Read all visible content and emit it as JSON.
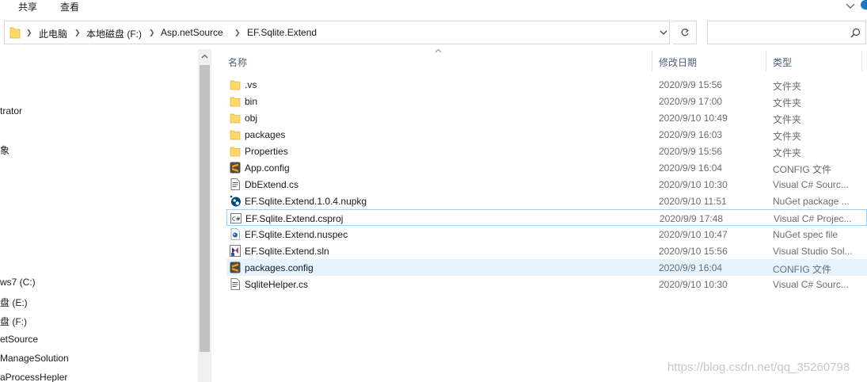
{
  "ribbon": {
    "tabs": [
      "共享",
      "查看"
    ]
  },
  "address": {
    "crumbs": [
      "此电脑",
      "本地磁盘 (F:)",
      "Asp.netSource",
      "EF.Sqlite.Extend"
    ],
    "search_placeholder": ""
  },
  "nav": {
    "items": [
      "trator",
      "象",
      "ws7 (C:)",
      "盘 (E:)",
      "盘 (F:)",
      "etSource",
      "ManageSolution",
      "aProcessHepler"
    ]
  },
  "columns": {
    "name": "名称",
    "date": "修改日期",
    "type": "类型"
  },
  "files": [
    {
      "name": ".vs",
      "date": "2020/9/9 15:56",
      "type": "文件夹",
      "icon": "folder-icon"
    },
    {
      "name": "bin",
      "date": "2020/9/9 17:00",
      "type": "文件夹",
      "icon": "folder-icon"
    },
    {
      "name": "obj",
      "date": "2020/9/10 10:49",
      "type": "文件夹",
      "icon": "folder-icon"
    },
    {
      "name": "packages",
      "date": "2020/9/9 16:03",
      "type": "文件夹",
      "icon": "folder-icon"
    },
    {
      "name": "Properties",
      "date": "2020/9/9 15:56",
      "type": "文件夹",
      "icon": "folder-icon"
    },
    {
      "name": "App.config",
      "date": "2020/9/9 16:04",
      "type": "CONFIG 文件",
      "icon": "sublime-file-icon"
    },
    {
      "name": "DbExtend.cs",
      "date": "2020/9/10 10:30",
      "type": "Visual C# Sourc...",
      "icon": "cs-file-icon"
    },
    {
      "name": "EF.Sqlite.Extend.1.0.4.nupkg",
      "date": "2020/9/10 11:51",
      "type": "NuGet package ...",
      "icon": "nuget-package-icon"
    },
    {
      "name": "EF.Sqlite.Extend.csproj",
      "date": "2020/9/9 17:48",
      "type": "Visual C# Projec...",
      "icon": "csproj-icon"
    },
    {
      "name": "EF.Sqlite.Extend.nuspec",
      "date": "2020/9/10 10:47",
      "type": "NuGet spec file",
      "icon": "nuspec-icon"
    },
    {
      "name": "EF.Sqlite.Extend.sln",
      "date": "2020/9/10 15:56",
      "type": "Visual Studio Sol...",
      "icon": "visual-studio-sln-icon"
    },
    {
      "name": "packages.config",
      "date": "2020/9/9 16:04",
      "type": "CONFIG 文件",
      "icon": "sublime-file-icon"
    },
    {
      "name": "SqliteHelper.cs",
      "date": "2020/9/10 10:30",
      "type": "Visual C# Sourc...",
      "icon": "cs-file-icon"
    }
  ],
  "watermark": "https://blog.csdn.net/qq_35260798",
  "colors": {
    "hover_row": "#e5f3ff",
    "focus_border": "#99d1ff",
    "folder": "#ffd866",
    "header_text": "#4c607a"
  }
}
